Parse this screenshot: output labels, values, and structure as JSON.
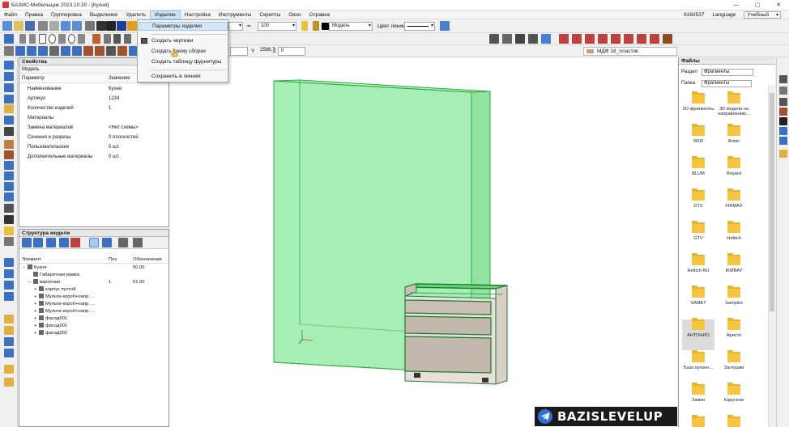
{
  "window": {
    "title": "БАЗИС-Мебельщик 2023.10.30 - [Кухня]",
    "controls": [
      "—",
      "▢",
      "✕"
    ]
  },
  "menubar": {
    "items": [
      "Файл",
      "Правка",
      "Группировка",
      "Выделение",
      "Удалить",
      "Изделие",
      "Настройка",
      "Инструменты",
      "Скрипты",
      "Окно",
      "Справка"
    ],
    "active": "Изделие",
    "right": {
      "code": "6160537",
      "language": "Language",
      "mode": "Учебный"
    }
  },
  "dropdown": {
    "items": [
      "Параметры изделия",
      "Создать чертежи",
      "Создать схему сборки",
      "Создать таблицу фурнитуры",
      "Сохранить в линиях"
    ],
    "highlighted": "Параметры изделия"
  },
  "toolbar": {
    "zoom": "100",
    "layer": "Модель",
    "line_color_label": "Цвет линии",
    "coord_y_label": "Y",
    "coord_y_value": "2588,7",
    "coord_z_label": "Z",
    "coord_z_value": "0"
  },
  "material": {
    "name": "МДФ 18_пластик",
    "color": "#c8a070"
  },
  "properties": {
    "title": "Свойства",
    "sub": "Модель",
    "header": {
      "param": "Параметр",
      "value": "Значение"
    },
    "rows": [
      {
        "k": "Наименование",
        "v": "Кухня"
      },
      {
        "k": "Артикул",
        "v": "1234"
      },
      {
        "k": "Количество изделий",
        "v": "1"
      },
      {
        "k": "Материалы",
        "v": ""
      },
      {
        "k": "Замена материалов",
        "v": "<Нет схемы>"
      },
      {
        "k": "Сечения и разрезы",
        "v": "0 плоскостей"
      },
      {
        "k": "Пользовательские",
        "v": "0 шт."
      },
      {
        "k": "Дополнительные материалы",
        "v": "0 шт."
      }
    ]
  },
  "structure": {
    "title": "Структура модели",
    "header": {
      "el": "Элемент",
      "pos": "Поз.",
      "des": "Обозначение"
    },
    "rows": [
      {
        "n": "Кухня",
        "p": "",
        "o": "00.00",
        "lvl": 0,
        "exp": "−"
      },
      {
        "n": "Габаритная рамка",
        "p": "",
        "o": "",
        "lvl": 1,
        "exp": ""
      },
      {
        "n": "варочная",
        "p": "1",
        "o": "01.00",
        "lvl": 1,
        "exp": "−"
      },
      {
        "n": "корпус пустой",
        "p": "",
        "o": "",
        "lvl": 2,
        "exp": "+"
      },
      {
        "n": "Мульти-короб+напр. ...",
        "p": "",
        "o": "",
        "lvl": 2,
        "exp": "+"
      },
      {
        "n": "Мульти-короб+напр. ...",
        "p": "",
        "o": "",
        "lvl": 2,
        "exp": "+"
      },
      {
        "n": "Мульти-короб+напр. ...",
        "p": "",
        "o": "",
        "lvl": 2,
        "exp": "+"
      },
      {
        "n": "фасад001",
        "p": "",
        "o": "",
        "lvl": 2,
        "exp": "+"
      },
      {
        "n": "фасад001",
        "p": "",
        "o": "",
        "lvl": 2,
        "exp": "+"
      },
      {
        "n": "фасад001",
        "p": "",
        "o": "",
        "lvl": 2,
        "exp": "+"
      }
    ]
  },
  "files": {
    "title": "Файлы",
    "section_label": "Раздел",
    "section_value": "Фрагменты",
    "folder_label": "Папка",
    "folder_value": "Фрагменты",
    "folders": [
      "2D-фрагменты",
      "3D модели на направлению...",
      "0600",
      "Aristo",
      "BLUM",
      "Boyard",
      "DTS",
      "FIRMAX",
      "GTV",
      "Hettich",
      "Hettich RU",
      "IKMBAY",
      "SAMET",
      "Samples",
      "АНТОНИО",
      "Аристо",
      "База кухонн...",
      "Заглушки",
      "Замки",
      "Карусели",
      "",
      ""
    ],
    "selected": "АНТОНИО"
  },
  "watermark": {
    "text": "BAZISLEVELUP"
  },
  "colors": {
    "model_green": "#3fd35a",
    "accent": "#2f6fd6",
    "folder": "#f5c542"
  }
}
